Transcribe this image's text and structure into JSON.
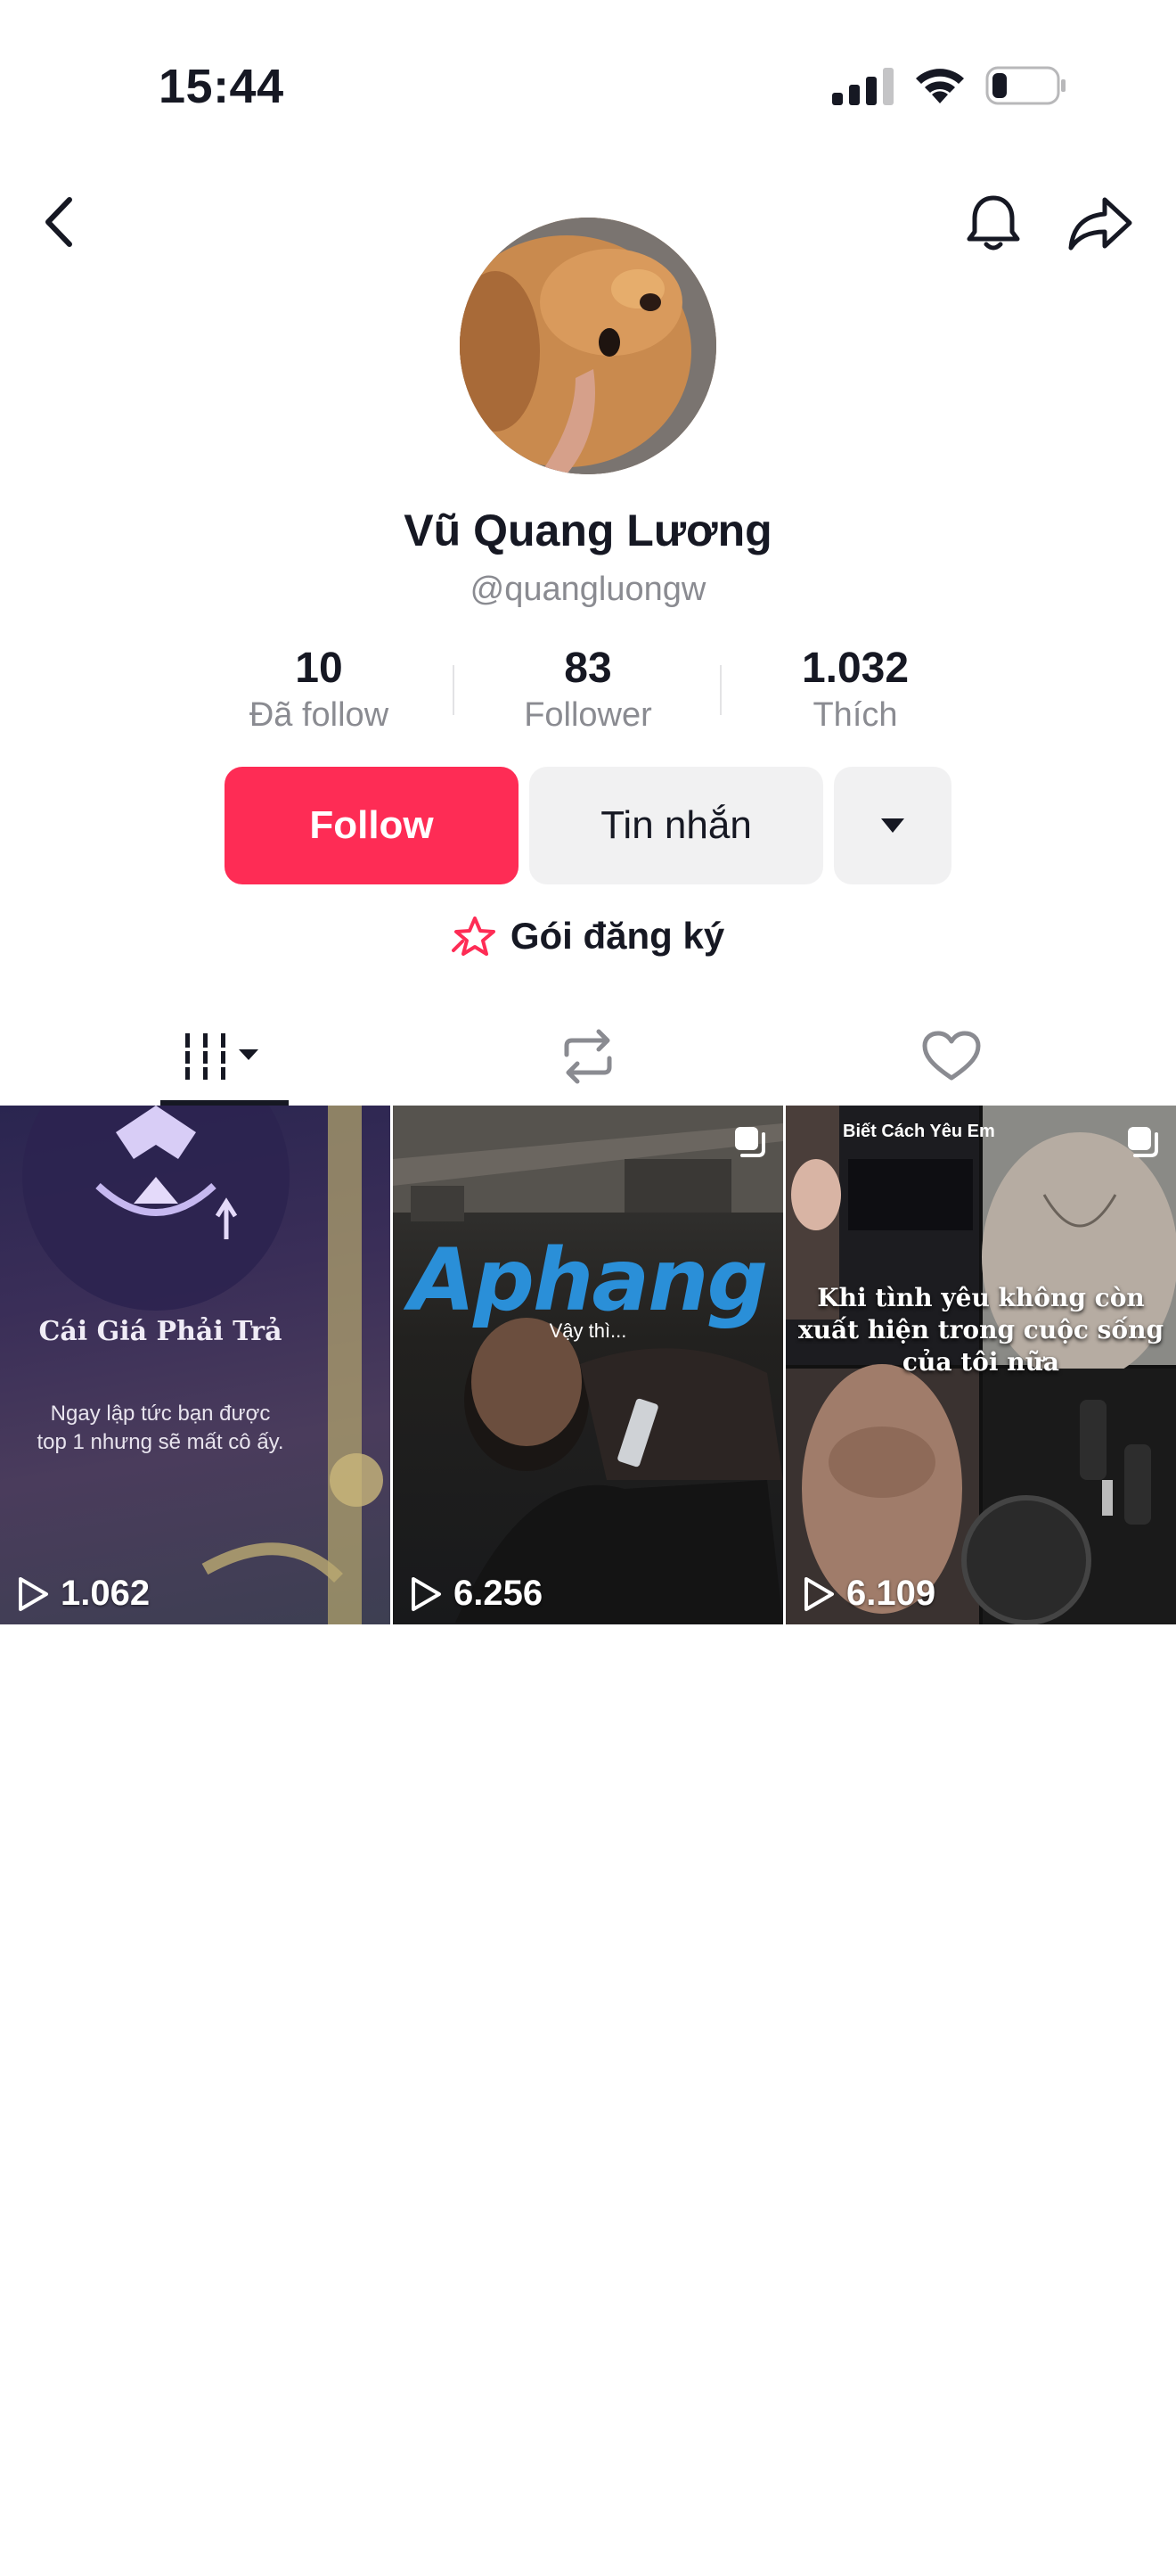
{
  "status_bar": {
    "time": "15:44"
  },
  "icons": {
    "back": "chevron-left-icon",
    "bell": "bell-icon",
    "share": "share-arrow-icon",
    "more": "caret-down-icon",
    "subscription": "star-icon",
    "videos_tab": "grid-bars-icon",
    "reposts_tab": "repost-icon",
    "liked_tab": "heart-icon",
    "play": "play-icon"
  },
  "profile": {
    "display_name": "Vũ Quang Lương",
    "username": "@quangluongw"
  },
  "stats": [
    {
      "value": "10",
      "label": "Đã follow"
    },
    {
      "value": "83",
      "label": "Follower"
    },
    {
      "value": "1.032",
      "label": "Thích"
    }
  ],
  "actions": {
    "follow": "Follow",
    "message": "Tin nhắn"
  },
  "subscription": {
    "label": "Gói đăng ký"
  },
  "colors": {
    "accent": "#fe2c55",
    "secondary_button": "#f1f1f2",
    "muted_text": "#8a8b91"
  },
  "videos": [
    {
      "title": "Cái Giá Phải Trả",
      "subtitle": "Ngay lập tức bạn được top 1 nhưng sẽ mất cô ấy.",
      "views": "1.062"
    },
    {
      "brand": "Aphang",
      "caption": "Vậy thì...",
      "views": "6.256"
    },
    {
      "top_text": "Biết Cách Yêu Em",
      "caption": "Khi tình yêu không còn xuất hiện trong cuộc sống của tôi nữa",
      "views": "6.109"
    }
  ]
}
